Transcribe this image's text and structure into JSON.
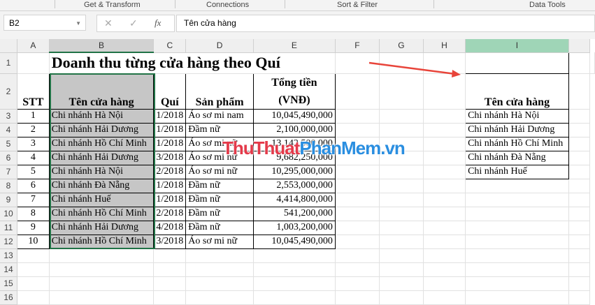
{
  "ribbon": {
    "groups": [
      "Get & Transform",
      "Connections",
      "Sort & Filter",
      "Data Tools"
    ]
  },
  "formula_bar": {
    "name_box": "B2",
    "formula": "Tên cửa hàng",
    "cancel_icon": "✕",
    "enter_icon": "✓",
    "fx_icon": "fx"
  },
  "columns": [
    "A",
    "B",
    "C",
    "D",
    "E",
    "F",
    "G",
    "H",
    "I"
  ],
  "title": "Doanh thu từng cửa hàng theo Quí",
  "headers": {
    "stt": "STT",
    "store": "Tên cửa hàng",
    "quarter": "Quí",
    "product": "Sản phẩm",
    "total": "Tổng tiền (VNĐ)"
  },
  "rows": [
    [
      "1",
      "Chi nhánh Hà Nội",
      "1/2018",
      "Áo sơ mi nam",
      "10,045,490,000"
    ],
    [
      "2",
      "Chi nhánh Hải Dương",
      "1/2018",
      "Đầm nữ",
      "2,100,000,000"
    ],
    [
      "3",
      "Chi nhánh Hồ Chí Minh",
      "1/2018",
      "Áo sơ mi nữ",
      "13,142,500,000"
    ],
    [
      "4",
      "Chi nhánh Hải Dương",
      "3/2018",
      "Áo sơ mi nữ",
      "9,682,250,000"
    ],
    [
      "5",
      "Chi nhánh Hà Nội",
      "2/2018",
      "Áo sơ mi nữ",
      "10,295,000,000"
    ],
    [
      "6",
      "Chi nhánh Đà Nẵng",
      "1/2018",
      "Đầm nữ",
      "2,553,000,000"
    ],
    [
      "7",
      "Chi nhánh Huế",
      "1/2018",
      "Đầm nữ",
      "4,414,800,000"
    ],
    [
      "8",
      "Chi nhánh Hồ Chí Minh",
      "2/2018",
      "Đầm nữ",
      "541,200,000"
    ],
    [
      "9",
      "Chi nhánh Hải Dương",
      "4/2018",
      "Đầm nữ",
      "1,003,200,000"
    ],
    [
      "10",
      "Chi nhánh Hồ Chí Minh",
      "3/2018",
      "Áo sơ mi nữ",
      "10,045,490,000"
    ]
  ],
  "unique_header": "Tên cửa hàng",
  "unique_stores": [
    "Chi nhánh Hà Nội",
    "Chi nhánh Hải Dương",
    "Chi nhánh Hồ Chí Minh",
    "Chi nhánh Đà Nẵng",
    "Chi nhánh Huế"
  ],
  "watermark": {
    "part1": "ThuThuat",
    "part2": "PhanMem",
    "part3": ".vn"
  }
}
